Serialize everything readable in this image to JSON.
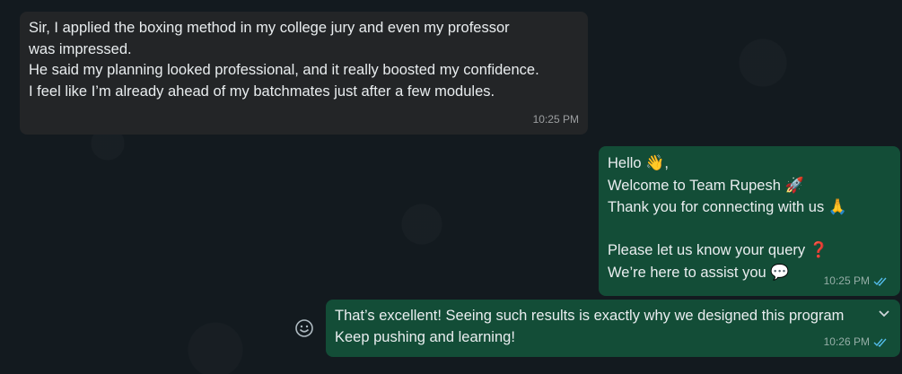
{
  "messages": {
    "incoming_1": {
      "lines": [
        "Sir, I applied the boxing method in my college jury and even my professor",
        "was impressed.",
        "He said my planning looked professional, and it really boosted my confidence.",
        "I feel like I’m already ahead of my batchmates just after a few modules."
      ],
      "time": "10:25 PM"
    },
    "outgoing_1": {
      "line1": "Hello",
      "line1_emoji": "👋",
      "line1_suffix": ",",
      "line2": "Welcome to Team Rupesh",
      "line2_emoji": "🚀",
      "line3": "Thank you for connecting with us",
      "line3_emoji": "🙏",
      "line4": "Please let us know your query",
      "line4_emoji": "❓",
      "line5": "We’re here to assist you",
      "line5_emoji": "💬",
      "time": "10:25 PM",
      "status": "read"
    },
    "outgoing_2": {
      "line1": "That’s excellent! Seeing such results is exactly why we designed this program",
      "line2": "Keep pushing and learning!",
      "time": "10:26 PM",
      "status": "read"
    }
  },
  "colors": {
    "background": "#131a1f",
    "incoming_bubble": "#232527",
    "outgoing_bubble": "#134d37",
    "read_ticks": "#53bdeb"
  },
  "icons": {
    "reaction": "smiley-icon",
    "menu": "chevron-down-icon",
    "read": "double-check-icon"
  }
}
